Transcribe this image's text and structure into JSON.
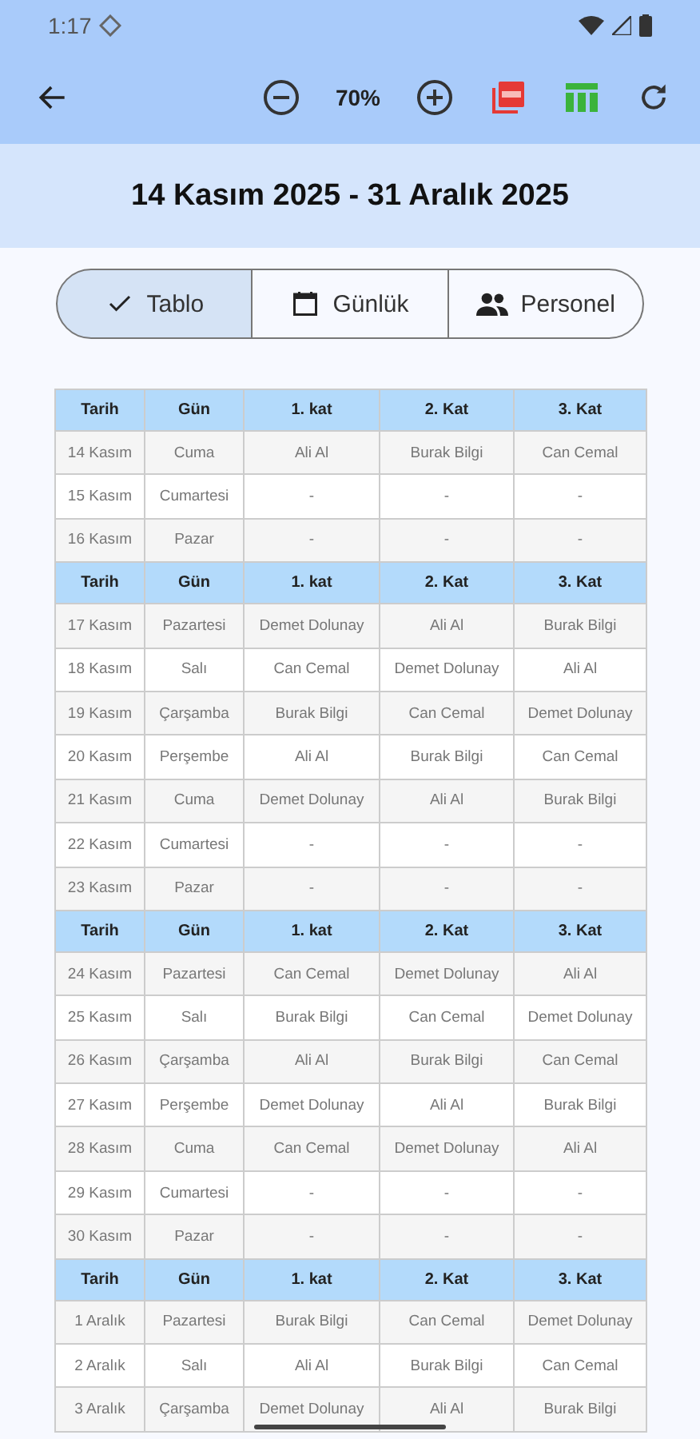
{
  "status_bar": {
    "time": "1:17"
  },
  "toolbar": {
    "zoom": "70%"
  },
  "title": "14 Kasım 2025 - 31 Aralık 2025",
  "segments": [
    {
      "label": "Tablo",
      "selected": true
    },
    {
      "label": "Günlük",
      "selected": false
    },
    {
      "label": "Personel",
      "selected": false
    }
  ],
  "blocks": [
    {
      "columns": [
        "Tarih",
        "Gün",
        "1. kat",
        "2. Kat",
        "3. Kat"
      ],
      "rows": [
        [
          "14 Kasım",
          "Cuma",
          "Ali Al",
          "Burak Bilgi",
          "Can Cemal"
        ],
        [
          "15 Kasım",
          "Cumartesi",
          "-",
          "-",
          "-"
        ],
        [
          "16 Kasım",
          "Pazar",
          "-",
          "-",
          "-"
        ]
      ]
    },
    {
      "columns": [
        "Tarih",
        "Gün",
        "1. kat",
        "2. Kat",
        "3. Kat"
      ],
      "rows": [
        [
          "17 Kasım",
          "Pazartesi",
          "Demet Dolunay",
          "Ali Al",
          "Burak Bilgi"
        ],
        [
          "18 Kasım",
          "Salı",
          "Can Cemal",
          "Demet Dolunay",
          "Ali Al"
        ],
        [
          "19 Kasım",
          "Çarşamba",
          "Burak Bilgi",
          "Can Cemal",
          "Demet Dolunay"
        ],
        [
          "20 Kasım",
          "Perşembe",
          "Ali Al",
          "Burak Bilgi",
          "Can Cemal"
        ],
        [
          "21 Kasım",
          "Cuma",
          "Demet Dolunay",
          "Ali Al",
          "Burak Bilgi"
        ],
        [
          "22 Kasım",
          "Cumartesi",
          "-",
          "-",
          "-"
        ],
        [
          "23 Kasım",
          "Pazar",
          "-",
          "-",
          "-"
        ]
      ]
    },
    {
      "columns": [
        "Tarih",
        "Gün",
        "1. kat",
        "2. Kat",
        "3. Kat"
      ],
      "rows": [
        [
          "24 Kasım",
          "Pazartesi",
          "Can Cemal",
          "Demet Dolunay",
          "Ali Al"
        ],
        [
          "25 Kasım",
          "Salı",
          "Burak Bilgi",
          "Can Cemal",
          "Demet Dolunay"
        ],
        [
          "26 Kasım",
          "Çarşamba",
          "Ali Al",
          "Burak Bilgi",
          "Can Cemal"
        ],
        [
          "27 Kasım",
          "Perşembe",
          "Demet Dolunay",
          "Ali Al",
          "Burak Bilgi"
        ],
        [
          "28 Kasım",
          "Cuma",
          "Can Cemal",
          "Demet Dolunay",
          "Ali Al"
        ],
        [
          "29 Kasım",
          "Cumartesi",
          "-",
          "-",
          "-"
        ],
        [
          "30 Kasım",
          "Pazar",
          "-",
          "-",
          "-"
        ]
      ]
    },
    {
      "columns": [
        "Tarih",
        "Gün",
        "1. kat",
        "2. Kat",
        "3. Kat"
      ],
      "rows": [
        [
          "1 Aralık",
          "Pazartesi",
          "Burak Bilgi",
          "Can Cemal",
          "Demet Dolunay"
        ],
        [
          "2 Aralık",
          "Salı",
          "Ali Al",
          "Burak Bilgi",
          "Can Cemal"
        ],
        [
          "3 Aralık",
          "Çarşamba",
          "Demet Dolunay",
          "Ali Al",
          "Burak Bilgi"
        ]
      ]
    }
  ]
}
